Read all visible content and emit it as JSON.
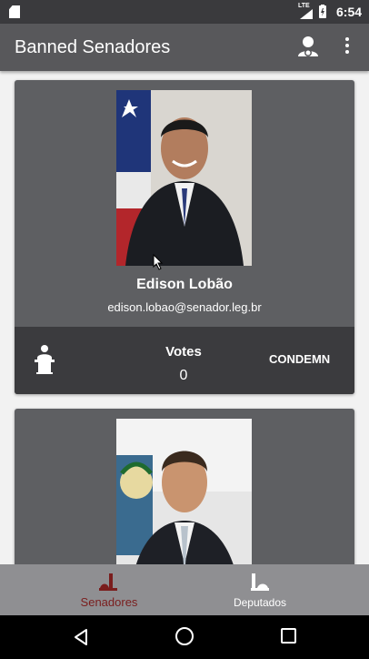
{
  "status_bar": {
    "network": "LTE",
    "time": "6:54"
  },
  "app_bar": {
    "title": "Banned Senadores",
    "icons": [
      "account-icon",
      "more-vert-icon"
    ]
  },
  "senadores": [
    {
      "name": "Edison Lobão",
      "email": "edison.lobao@senador.leg.br",
      "votes_label": "Votes",
      "votes": "0",
      "action_label": "CONDEMN"
    },
    {
      "name": "",
      "email": ""
    }
  ],
  "bottom_nav": {
    "items": [
      {
        "label": "Senadores",
        "icon": "senate-icon",
        "active": true,
        "color": "#7a1d1d"
      },
      {
        "label": "Deputados",
        "icon": "chamber-icon",
        "active": false,
        "color": "#ffffff"
      }
    ]
  },
  "colors": {
    "app_bar": "#58585b",
    "card": "#5e5f62",
    "vote_bar": "#3b3b3e",
    "accent_active": "#7a1d1d"
  }
}
